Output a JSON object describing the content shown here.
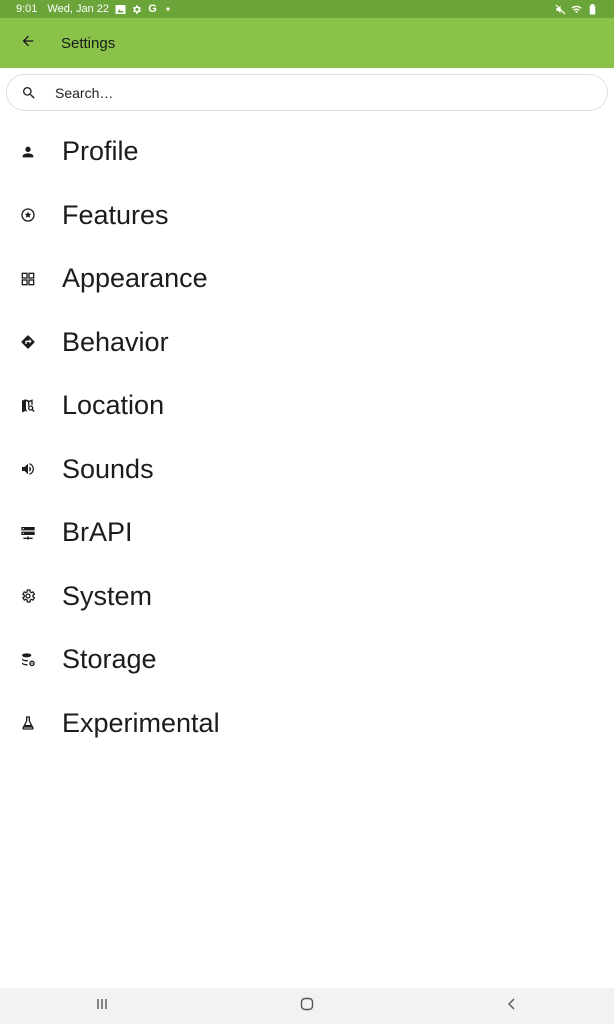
{
  "status_bar": {
    "time": "9:01",
    "date": "Wed, Jan 22",
    "left_icons": [
      "image-icon",
      "gear-icon",
      "google-icon",
      "dot-icon"
    ],
    "right_icons": [
      "mute-icon",
      "wifi-icon",
      "battery-icon"
    ]
  },
  "app_bar": {
    "title": "Settings",
    "back_icon": "arrow-back-icon",
    "color": "#8bc34a"
  },
  "search": {
    "placeholder": "Search…"
  },
  "settings": [
    {
      "label": "Profile",
      "icon": "person-icon"
    },
    {
      "label": "Features",
      "icon": "star-circle-icon"
    },
    {
      "label": "Appearance",
      "icon": "grid-icon"
    },
    {
      "label": "Behavior",
      "icon": "directions-icon"
    },
    {
      "label": "Location",
      "icon": "map-search-icon"
    },
    {
      "label": "Sounds",
      "icon": "volume-icon"
    },
    {
      "label": "BrAPI",
      "icon": "server-icon"
    },
    {
      "label": "System",
      "icon": "gear-icon"
    },
    {
      "label": "Storage",
      "icon": "database-cog-icon"
    },
    {
      "label": "Experimental",
      "icon": "flask-icon"
    }
  ],
  "nav_bar": {
    "buttons": [
      "recent-apps-icon",
      "home-icon",
      "back-icon"
    ]
  }
}
